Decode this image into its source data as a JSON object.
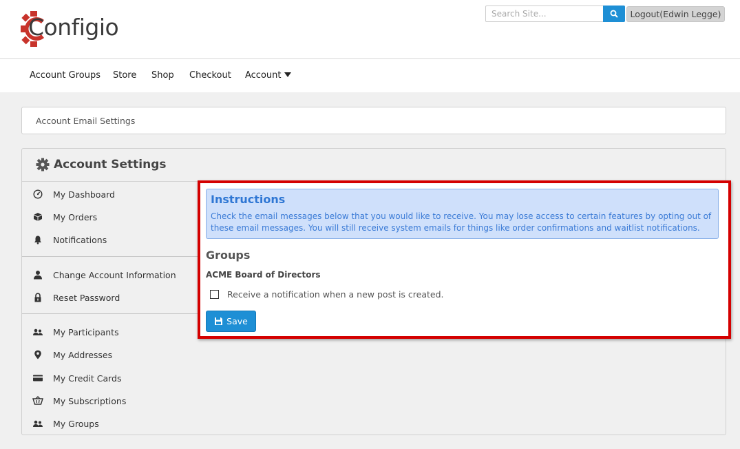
{
  "brand": {
    "name": "Configio",
    "accent": "#c8332b"
  },
  "header": {
    "search_placeholder": "Search Site...",
    "search_icon": "search-icon",
    "logout_label": "Logout(Edwin Legge)"
  },
  "nav": {
    "items": [
      {
        "label": "Account Groups"
      },
      {
        "label": "Store"
      },
      {
        "label": "Shop"
      },
      {
        "label": "Checkout"
      },
      {
        "label": "Account",
        "icon": "caret-down-icon"
      }
    ]
  },
  "breadcrumb": {
    "current": "Account Email Settings"
  },
  "sidebar": {
    "title": "Account Settings",
    "title_icon": "gear-icon",
    "items": [
      {
        "label": "My Dashboard",
        "icon": "dashboard-gauge-icon"
      },
      {
        "label": "My Orders",
        "icon": "box-icon"
      },
      {
        "label": "Notifications",
        "icon": "bell-icon"
      },
      {
        "label": "Change Account Information",
        "icon": "user-icon"
      },
      {
        "label": "Reset Password",
        "icon": "lock-icon"
      },
      {
        "label": "My Participants",
        "icon": "users-icon"
      },
      {
        "label": "My Addresses",
        "icon": "map-pin-icon"
      },
      {
        "label": "My Credit Cards",
        "icon": "credit-card-icon"
      },
      {
        "label": "My Subscriptions",
        "icon": "subscription-basket-icon"
      },
      {
        "label": "My Groups",
        "icon": "group-icon"
      }
    ]
  },
  "content": {
    "instructions_title": "Instructions",
    "instructions_text": "Check the email messages below that you would like to receive. You may lose access to certain features by opting out of these email messages. You will still receive system emails for things like order confirmations and waitlist notifications.",
    "groups_heading": "Groups",
    "group_name": "ACME Board of Directors",
    "checkbox_label": "Receive a notification when a new post is created.",
    "checkbox_checked": false,
    "save_label": "Save",
    "save_icon": "floppy-disk-icon"
  },
  "colors": {
    "primary_button": "#1e8fd5",
    "highlight_border": "#d40000",
    "instructions_bg": "#cfe0fb",
    "instructions_text": "#2f77d4"
  }
}
